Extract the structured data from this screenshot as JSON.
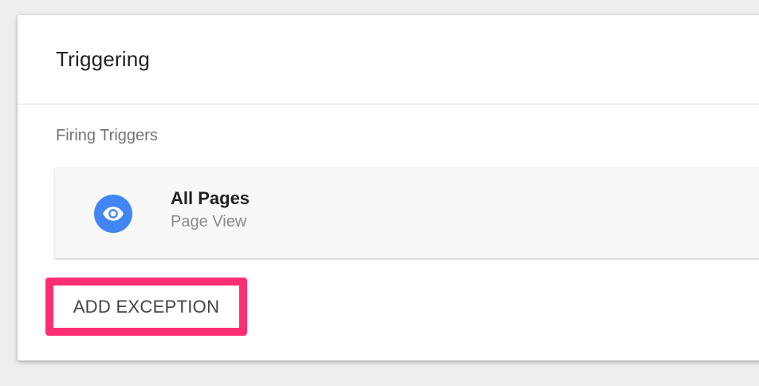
{
  "panel": {
    "title": "Triggering",
    "section_label": "Firing Triggers"
  },
  "trigger": {
    "name": "All Pages",
    "type": "Page View",
    "icon": "eye-icon",
    "icon_color": "#4285f4"
  },
  "actions": {
    "add_exception_label": "ADD EXCEPTION",
    "highlight_color": "#ff2d72"
  }
}
